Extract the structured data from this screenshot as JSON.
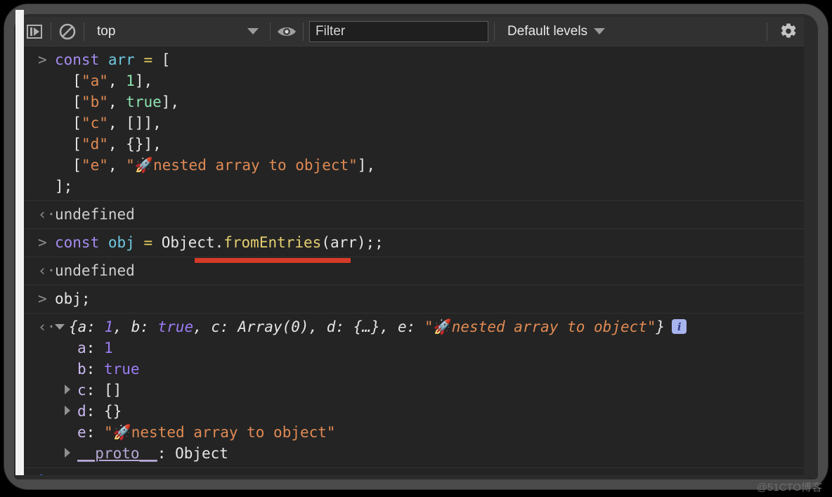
{
  "toolbar": {
    "resume_icon": "step-into-icon",
    "clear_icon": "clear-console-icon",
    "context_label": "top",
    "context_caret_icon": "chevron-down-icon",
    "eye_icon": "live-expression-eye-icon",
    "filter_placeholder": "Filter",
    "filter_value": "",
    "levels_label": "Default levels",
    "levels_caret_icon": "chevron-down-icon",
    "settings_icon": "gear-icon"
  },
  "console": {
    "entries": [
      {
        "kind": "input",
        "marker": ">",
        "lines": [
          [
            {
              "t": "const ",
              "c": "kw"
            },
            {
              "t": "arr ",
              "c": "var"
            },
            {
              "t": "= ",
              "c": "op"
            },
            {
              "t": "[",
              "c": "plain"
            }
          ],
          [
            {
              "t": "  [",
              "c": "plain"
            },
            {
              "t": "\"a\"",
              "c": "str"
            },
            {
              "t": ", ",
              "c": "plain"
            },
            {
              "t": "1",
              "c": "num"
            },
            {
              "t": "],",
              "c": "plain"
            }
          ],
          [
            {
              "t": "  [",
              "c": "plain"
            },
            {
              "t": "\"b\"",
              "c": "str"
            },
            {
              "t": ", ",
              "c": "plain"
            },
            {
              "t": "true",
              "c": "bool"
            },
            {
              "t": "],",
              "c": "plain"
            }
          ],
          [
            {
              "t": "  [",
              "c": "plain"
            },
            {
              "t": "\"c\"",
              "c": "str"
            },
            {
              "t": ", []],",
              "c": "plain"
            }
          ],
          [
            {
              "t": "  [",
              "c": "plain"
            },
            {
              "t": "\"d\"",
              "c": "str"
            },
            {
              "t": ", {}],",
              "c": "plain"
            }
          ],
          [
            {
              "t": "  [",
              "c": "plain"
            },
            {
              "t": "\"e\"",
              "c": "str"
            },
            {
              "t": ", ",
              "c": "plain"
            },
            {
              "t": "\"🚀nested array to object\"",
              "c": "str"
            },
            {
              "t": "],",
              "c": "plain"
            }
          ],
          [
            {
              "t": "];",
              "c": "plain"
            }
          ]
        ]
      },
      {
        "kind": "result",
        "marker": "‹·",
        "text": "undefined"
      },
      {
        "kind": "input",
        "marker": ">",
        "lines": [
          [
            {
              "t": "const ",
              "c": "kw"
            },
            {
              "t": "obj ",
              "c": "var"
            },
            {
              "t": "= ",
              "c": "op"
            },
            {
              "t": "Object.",
              "c": "plain"
            },
            {
              "t": "fromEntries",
              "c": "fn"
            },
            {
              "t": "(arr);;",
              "c": "plain"
            }
          ]
        ]
      },
      {
        "kind": "result",
        "marker": "‹·",
        "text": "undefined",
        "annotated": true
      },
      {
        "kind": "input",
        "marker": ">",
        "lines": [
          [
            {
              "t": "obj;",
              "c": "plain"
            }
          ]
        ]
      }
    ],
    "object_result": {
      "marker": "‹·",
      "toggle_icon": "triangle-down-icon",
      "preview_tokens": [
        {
          "t": "{",
          "c": "p-plain"
        },
        {
          "t": "a",
          "c": "p-key"
        },
        {
          "t": ": ",
          "c": "p-plain"
        },
        {
          "t": "1",
          "c": "p-num"
        },
        {
          "t": ", ",
          "c": "p-plain"
        },
        {
          "t": "b",
          "c": "p-key"
        },
        {
          "t": ": ",
          "c": "p-plain"
        },
        {
          "t": "true",
          "c": "p-bool"
        },
        {
          "t": ", ",
          "c": "p-plain"
        },
        {
          "t": "c",
          "c": "p-key"
        },
        {
          "t": ": ",
          "c": "p-plain"
        },
        {
          "t": "Array(0)",
          "c": "p-plain"
        },
        {
          "t": ", ",
          "c": "p-plain"
        },
        {
          "t": "d",
          "c": "p-key"
        },
        {
          "t": ": ",
          "c": "p-plain"
        },
        {
          "t": "{…}",
          "c": "p-plain"
        },
        {
          "t": ", ",
          "c": "p-plain"
        },
        {
          "t": "e",
          "c": "p-key"
        },
        {
          "t": ": ",
          "c": "p-plain"
        },
        {
          "t": "\"🚀nested array to object\"",
          "c": "p-str"
        },
        {
          "t": "}",
          "c": "p-plain"
        }
      ],
      "info_badge": "i",
      "properties": [
        {
          "expandable": false,
          "key": "a",
          "value": "1",
          "value_class": "prop-num"
        },
        {
          "expandable": false,
          "key": "b",
          "value": "true",
          "value_class": "prop-bool"
        },
        {
          "expandable": true,
          "key": "c",
          "value": "[]",
          "value_class": "prop-plain"
        },
        {
          "expandable": true,
          "key": "d",
          "value": "{}",
          "value_class": "prop-plain"
        },
        {
          "expandable": false,
          "key": "e",
          "value": "\"🚀nested array to object\"",
          "value_class": "prop-str"
        },
        {
          "expandable": true,
          "key": "__proto__",
          "value": "Object",
          "value_class": "prop-plain",
          "proto": true
        }
      ]
    },
    "prompt": {
      "caret": "❯",
      "value": "",
      "placeholder": ""
    }
  },
  "annotation": {
    "type": "red-underline",
    "color": "#d63a28"
  },
  "watermark": "@51CTO博客"
}
